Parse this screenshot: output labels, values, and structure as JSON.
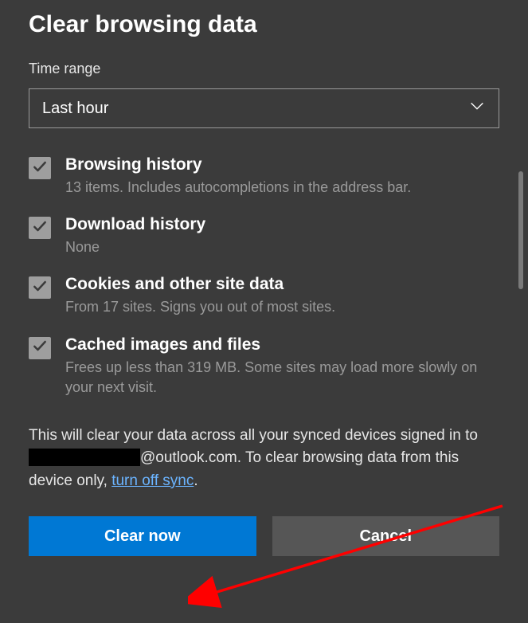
{
  "title": "Clear browsing data",
  "timeRangeLabel": "Time range",
  "select": {
    "value": "Last hour"
  },
  "options": [
    {
      "title": "Browsing history",
      "desc": "13 items. Includes autocompletions in the address bar."
    },
    {
      "title": "Download history",
      "desc": "None"
    },
    {
      "title": "Cookies and other site data",
      "desc": "From 17 sites. Signs you out of most sites."
    },
    {
      "title": "Cached images and files",
      "desc": "Frees up less than 319 MB. Some sites may load more slowly on your next visit."
    }
  ],
  "syncNote": {
    "pre": "This will clear your data across all your synced devices signed in to ",
    "emailDomain": "@outlook.com",
    "mid": ". To clear browsing data from this device only, ",
    "link": "turn off sync",
    "post": "."
  },
  "buttons": {
    "primary": "Clear now",
    "secondary": "Cancel"
  }
}
